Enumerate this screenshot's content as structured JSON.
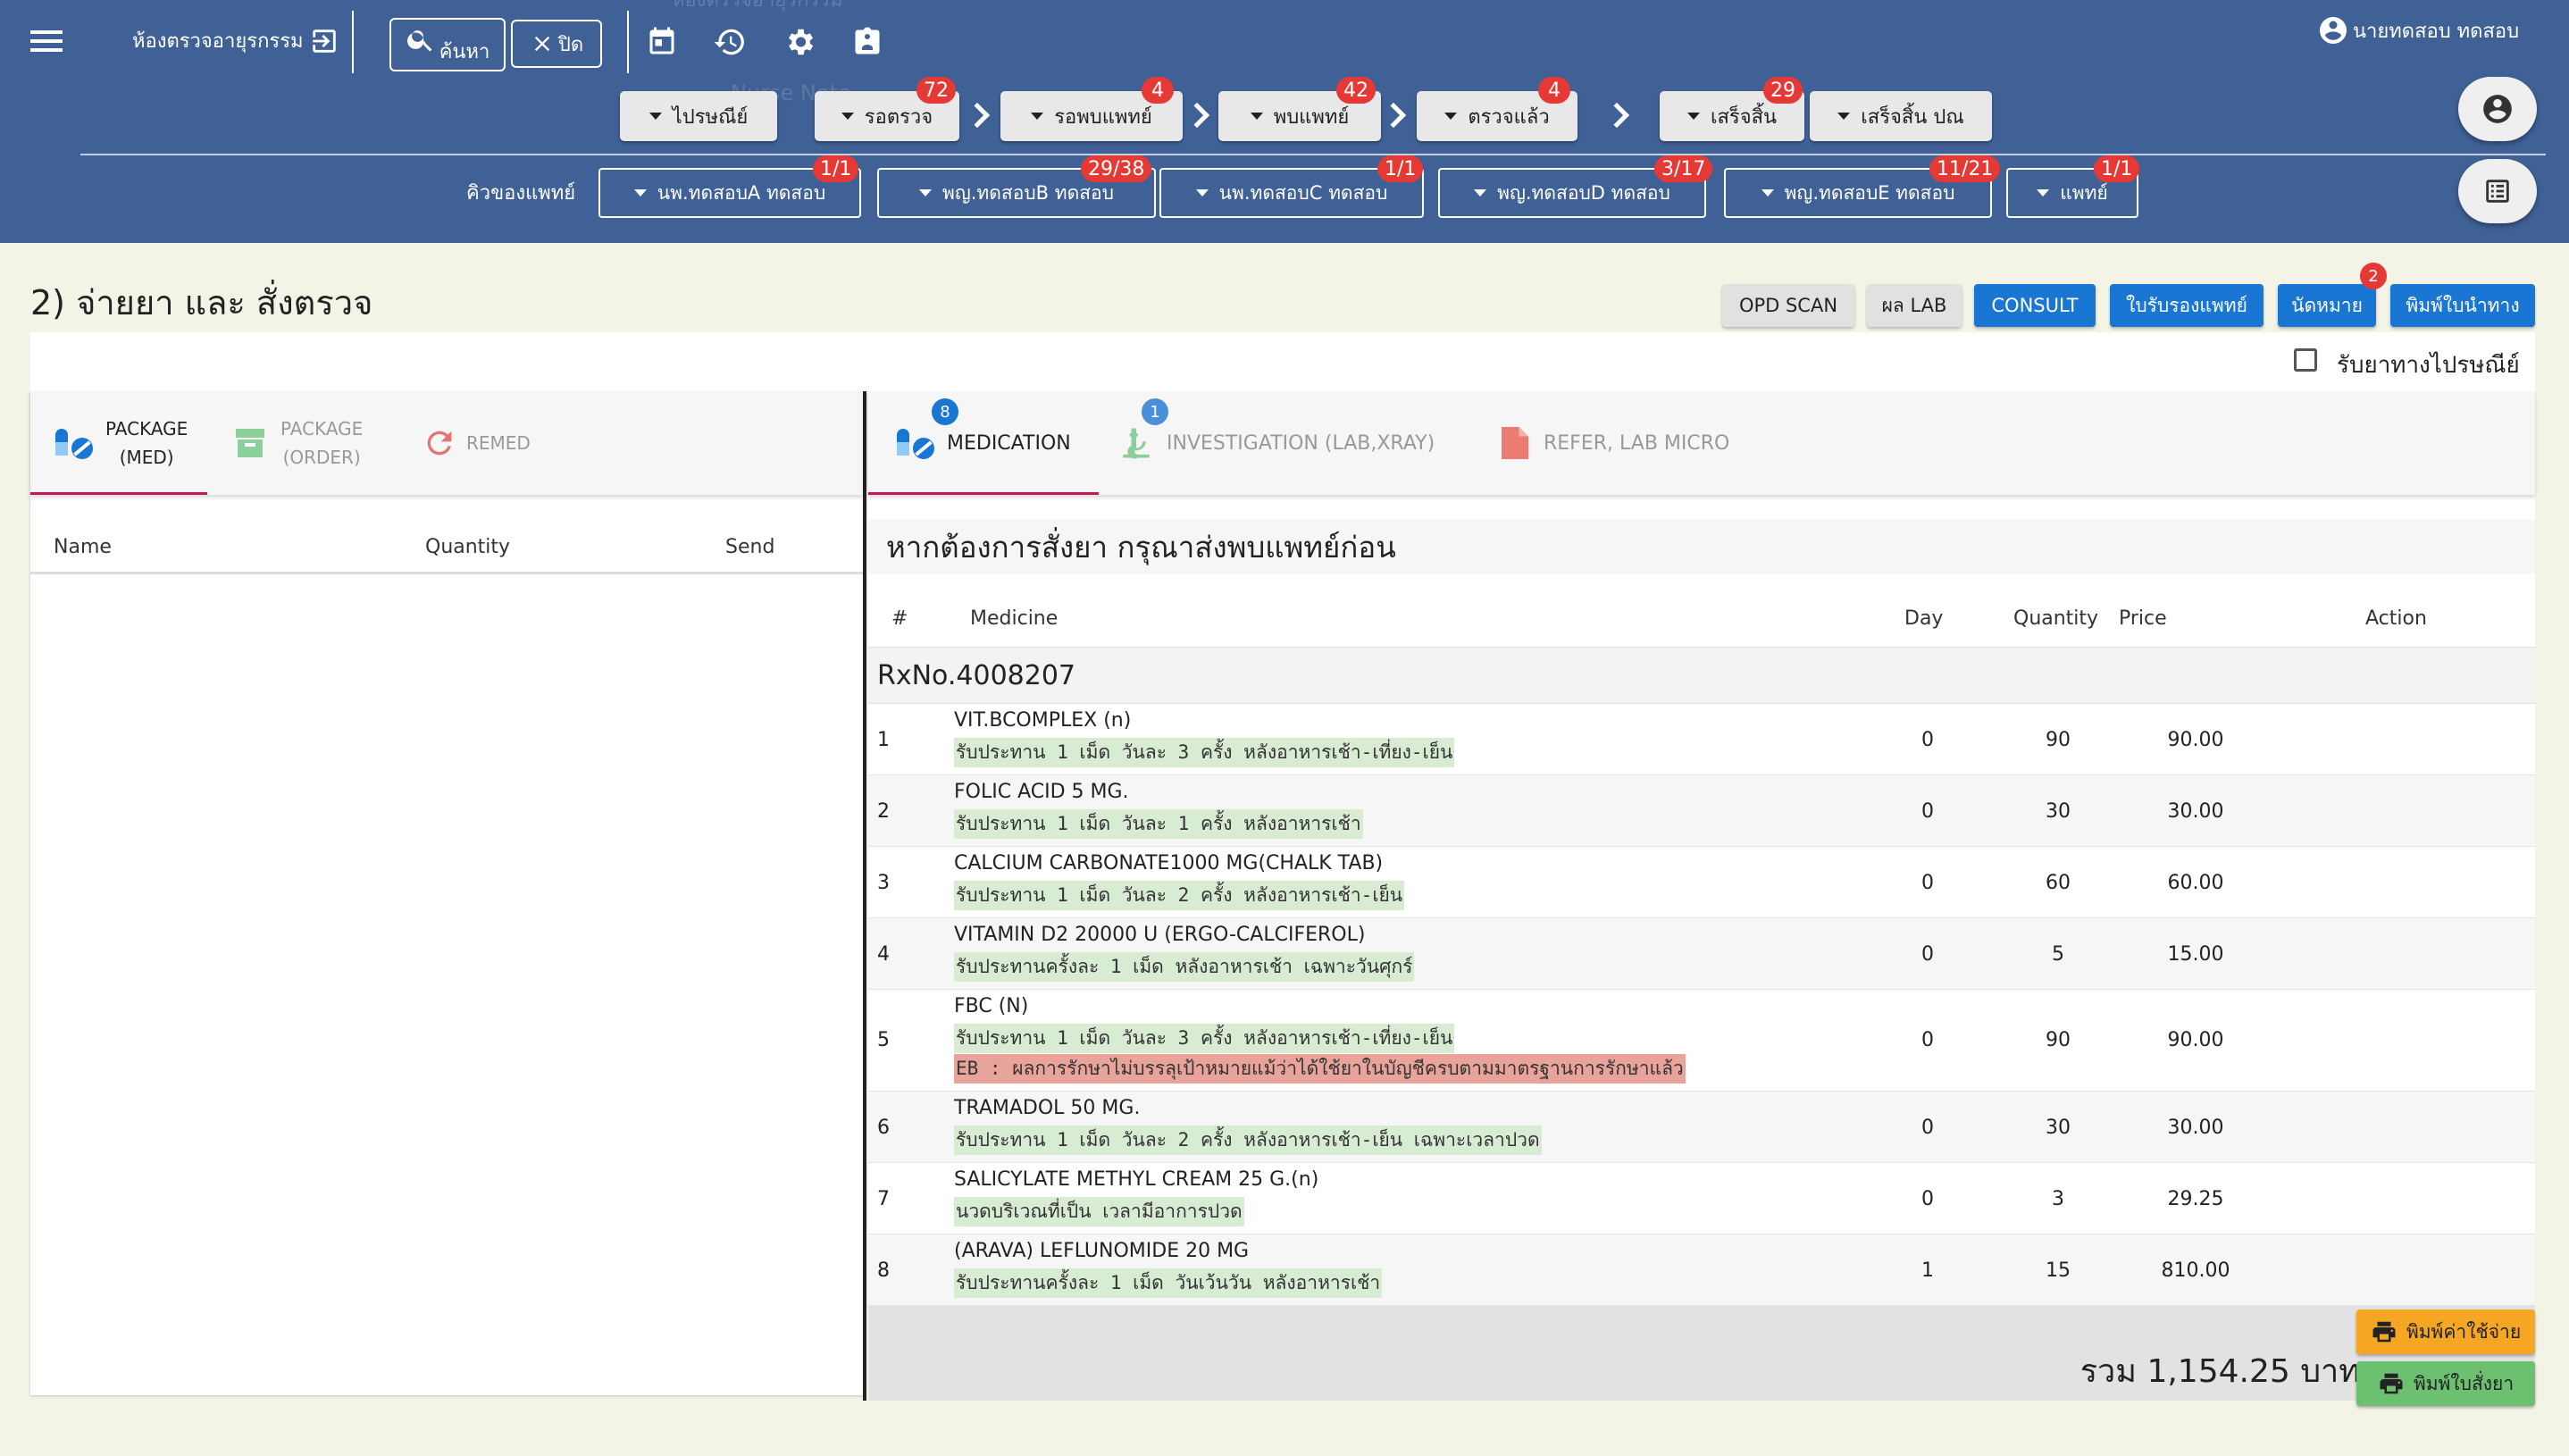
{
  "header": {
    "department": "ห้องตรวจอายุรกรรม",
    "search_label": "ค้นหา",
    "close_label": "ปิด",
    "user_name": "นายทดสอบ ทดสอบ",
    "ghost_text_1": "ห้องตรวจอายุรกรรม",
    "ghost_text_2": "Nurse Note"
  },
  "workflow": [
    {
      "label": "ไปรษณีย์",
      "count": ""
    },
    {
      "label": "รอตรวจ",
      "count": "72"
    },
    {
      "label": "รอพบแพทย์",
      "count": "4"
    },
    {
      "label": "พบแพทย์",
      "count": "42"
    },
    {
      "label": "ตรวจแล้ว",
      "count": "4"
    },
    {
      "label": "เสร็จสิ้น",
      "count": "29"
    },
    {
      "label": "เสร็จสิ้น ปณ",
      "count": ""
    }
  ],
  "doctor_queue": {
    "label": "คิวของแพทย์",
    "doctors": [
      {
        "label": "นพ.ทดสอบA ทดสอบ",
        "count": "1/1"
      },
      {
        "label": "พญ.ทดสอบB ทดสอบ",
        "count": "29/38"
      },
      {
        "label": "นพ.ทดสอบC ทดสอบ",
        "count": "1/1"
      },
      {
        "label": "พญ.ทดสอบD ทดสอบ",
        "count": "3/17"
      },
      {
        "label": "พญ.ทดสอบE ทดสอบ",
        "count": "11/21"
      },
      {
        "label": "แพทย์",
        "count": "1/1"
      }
    ]
  },
  "page": {
    "title": "2) จ่ายยา และ สั่งตรวจ",
    "buttons": {
      "opd_scan": "OPD SCAN",
      "lab_result": "ผล LAB",
      "consult": "CONSULT",
      "doctor_cert": "ใบรับรองแพทย์",
      "appointment": "นัดหมาย",
      "appointment_count": "2",
      "referral_print": "พิมพ์ใบนำทาง"
    },
    "postal_checkbox_label": "รับยาทางไปรษณีย์"
  },
  "left_panel": {
    "tabs": [
      {
        "line1": "PACKAGE",
        "line2": "(MED)"
      },
      {
        "line1": "PACKAGE",
        "line2": "(ORDER)"
      },
      {
        "line1": "REMED",
        "line2": ""
      }
    ],
    "columns": [
      "Name",
      "Quantity",
      "Send"
    ]
  },
  "right_panel": {
    "tabs": [
      {
        "label": "MEDICATION",
        "count": "8"
      },
      {
        "label": "INVESTIGATION (LAB,XRAY)",
        "count": "1"
      },
      {
        "label": "REFER, LAB MICRO",
        "count": ""
      }
    ],
    "notice": "หากต้องการสั่งยา กรุณาส่งพบแพทย์ก่อน",
    "columns": [
      "#",
      "Medicine",
      "Day",
      "Quantity",
      "Price",
      "Action"
    ],
    "rx_no": "RxNo.4008207",
    "medications": [
      {
        "num": "1",
        "name": "VIT.BCOMPLEX (n)",
        "instruction": "รับประทาน 1 เม็ด วันละ 3 ครั้ง หลังอาหารเช้า-เที่ยง-เย็น",
        "warning": "",
        "day": "0",
        "quantity": "90",
        "price": "90.00"
      },
      {
        "num": "2",
        "name": "FOLIC ACID 5 MG.",
        "instruction": "รับประทาน 1 เม็ด วันละ 1 ครั้ง หลังอาหารเช้า",
        "warning": "",
        "day": "0",
        "quantity": "30",
        "price": "30.00"
      },
      {
        "num": "3",
        "name": "CALCIUM CARBONATE1000 MG(CHALK TAB)",
        "instruction": "รับประทาน 1 เม็ด วันละ 2 ครั้ง หลังอาหารเช้า-เย็น",
        "warning": "",
        "day": "0",
        "quantity": "60",
        "price": "60.00"
      },
      {
        "num": "4",
        "name": "VITAMIN D2 20000 U (ERGO-CALCIFEROL)",
        "instruction": "รับประทานครั้งละ 1 เม็ด หลังอาหารเช้า เฉพาะวันศุกร์",
        "warning": "",
        "day": "0",
        "quantity": "5",
        "price": "15.00"
      },
      {
        "num": "5",
        "name": "FBC (N)",
        "instruction": "รับประทาน 1 เม็ด วันละ 3 ครั้ง หลังอาหารเช้า-เที่ยง-เย็น",
        "warning": "EB : ผลการรักษาไม่บรรลุเป้าหมายแม้ว่าได้ใช้ยาในบัญชีครบตามมาตรฐานการรักษาแล้ว",
        "day": "0",
        "quantity": "90",
        "price": "90.00"
      },
      {
        "num": "6",
        "name": "TRAMADOL 50 MG.",
        "instruction": "รับประทาน 1 เม็ด วันละ 2 ครั้ง หลังอาหารเช้า-เย็น เฉพาะเวลาปวด",
        "warning": "",
        "day": "0",
        "quantity": "30",
        "price": "30.00"
      },
      {
        "num": "7",
        "name": "SALICYLATE METHYL CREAM 25 G.(n)",
        "instruction": "นวดบริเวณที่เป็น เวลามีอาการปวด",
        "warning": "",
        "day": "0",
        "quantity": "3",
        "price": "29.25"
      },
      {
        "num": "8",
        "name": "(ARAVA) LEFLUNOMIDE 20 MG",
        "instruction": "รับประทานครั้งละ 1 เม็ด วันเว้นวัน หลังอาหารเช้า",
        "warning": "",
        "day": "1",
        "quantity": "15",
        "price": "810.00"
      }
    ],
    "total": "รวม 1,154.25 บาท",
    "print_expense": "พิมพ์ค่าใช้จ่าย",
    "print_order": "พิมพ์ใบสั่งยา"
  },
  "colors": {
    "header_bg": "#3f6196",
    "badge": "#e53935",
    "primary_blue": "#1976d2",
    "orange": "#f5a623",
    "green": "#6cc070"
  },
  "icons": [
    "menu-icon",
    "logout-icon",
    "search-icon",
    "close-icon",
    "calendar-icon",
    "history-icon",
    "gear-icon",
    "contact-icon",
    "account-circle-icon",
    "list-icon",
    "pill-icon",
    "box-icon",
    "redo-icon",
    "microscope-icon",
    "document-icon",
    "printer-icon"
  ]
}
